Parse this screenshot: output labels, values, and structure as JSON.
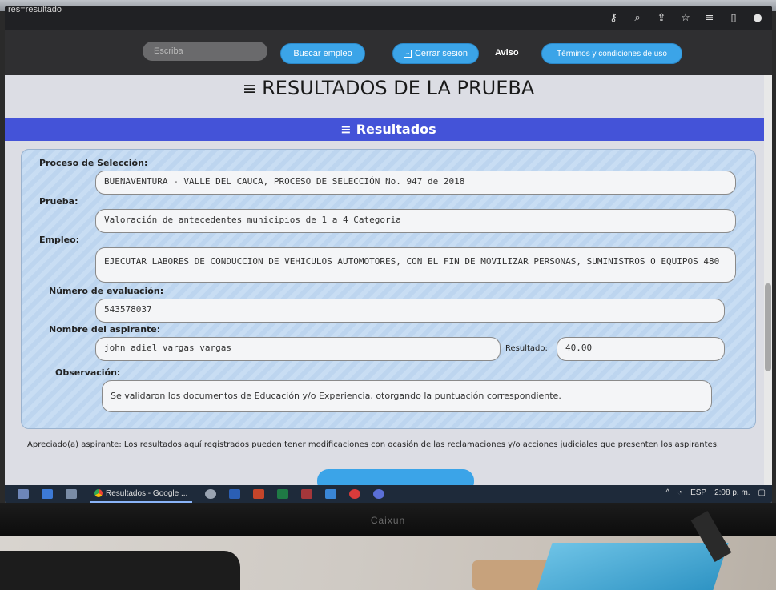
{
  "browser": {
    "tab_title": "res=resultado",
    "icons": [
      "key-icon",
      "zoom-icon",
      "share-icon",
      "star-icon",
      "reading-list-icon",
      "sidebar-icon",
      "profile-icon"
    ]
  },
  "nav": {
    "search_placeholder": "Escriba",
    "buscar_label": "Buscar empleo",
    "cerrar_label": "Cerrar sesión",
    "aviso_label": "Aviso",
    "terminos_label": "Términos y condiciones de uso"
  },
  "page": {
    "title": "RESULTADOS DE LA PRUEBA",
    "section_title": "Resultados"
  },
  "form": {
    "proceso_label_a": "Proceso de ",
    "proceso_label_b": "Selección:",
    "proceso_value": "BUENAVENTURA - VALLE DEL CAUCA, PROCESO DE SELECCIÓN No. 947 de 2018",
    "prueba_label": "Prueba:",
    "prueba_value": "Valoración de antecedentes municipios de 1 a 4 Categoria",
    "empleo_label": "Empleo:",
    "empleo_value": "EJECUTAR LABORES DE CONDUCCION DE VEHICULOS AUTOMOTORES, CON EL FIN DE MOVILIZAR PERSONAS, SUMINISTROS O EQUIPOS 480",
    "numero_label_a": "Número de ",
    "numero_label_b": "evaluación:",
    "numero_value": "543578037",
    "nombre_label": "Nombre del aspirante:",
    "nombre_value": "john adiel vargas vargas",
    "resultado_label": "Resultado:",
    "resultado_value": "40.00",
    "observacion_label": "Observación:",
    "observacion_value": "Se validaron los documentos de Educación y/o Experiencia, otorgando la puntuación correspondiente."
  },
  "notice": "Apreciado(a) aspirante: Los resultados aquí registrados pueden tener modificaciones con ocasión de las reclamaciones y/o acciones judiciales que presenten los aspirantes.",
  "taskbar": {
    "chrome_label": "Resultados - Google ...",
    "lang": "ESP",
    "time": "2:08 p. m."
  },
  "monitor": {
    "brand": "Caixun"
  }
}
